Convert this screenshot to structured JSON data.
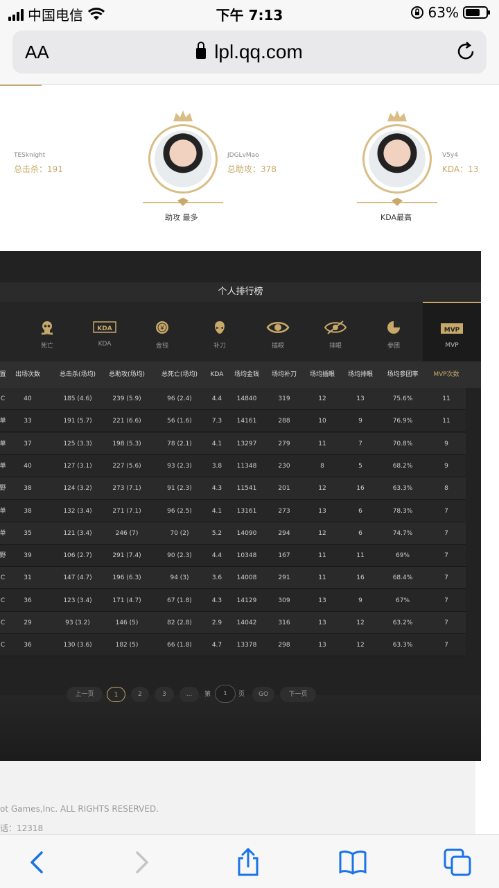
{
  "status_bar": {
    "carrier": "中国电信",
    "time": "下午 7:13",
    "battery": "63%"
  },
  "browser": {
    "text_size_label": "AA",
    "domain": "lpl.qq.com"
  },
  "top_players": [
    {
      "name": "TESknight",
      "stat": "总击杀：191",
      "caption": ""
    },
    {
      "name": "JDGLvMao",
      "stat": "总助攻：378",
      "caption": "助攻 最多"
    },
    {
      "name": "V5y4",
      "stat": "KDA：13",
      "caption": "KDA最高"
    }
  ],
  "ranking": {
    "title": "个人排行榜",
    "tabs": [
      {
        "label": "死亡",
        "icon": "skull-icon"
      },
      {
        "label": "KDA",
        "icon": "kda-icon"
      },
      {
        "label": "金钱",
        "icon": "coin-icon"
      },
      {
        "label": "补刀",
        "icon": "minion-icon"
      },
      {
        "label": "插眼",
        "icon": "eye-icon"
      },
      {
        "label": "排眼",
        "icon": "eye-slash-icon"
      },
      {
        "label": "参团",
        "icon": "pie-icon"
      },
      {
        "label": "MVP",
        "icon": "mvp-icon"
      }
    ],
    "active_tab": "MVP",
    "columns": [
      "置",
      "出场次数",
      "总击杀(场均)",
      "总助攻(场均)",
      "总死亡(场均)",
      "KDA",
      "场均金钱",
      "场均补刀",
      "场均插眼",
      "场均排眼",
      "场均参团率",
      "MVP次数"
    ],
    "rows": [
      [
        "C",
        "40",
        "185 (4.6)",
        "239 (5.9)",
        "96 (2.4)",
        "4.4",
        "14840",
        "319",
        "12",
        "13",
        "75.6%",
        "11"
      ],
      [
        "单",
        "33",
        "191 (5.7)",
        "221 (6.6)",
        "56 (1.6)",
        "7.3",
        "14161",
        "288",
        "10",
        "9",
        "76.9%",
        "11"
      ],
      [
        "单",
        "37",
        "125 (3.3)",
        "198 (5.3)",
        "78 (2.1)",
        "4.1",
        "13297",
        "279",
        "11",
        "7",
        "70.8%",
        "9"
      ],
      [
        "单",
        "40",
        "127 (3.1)",
        "227 (5.6)",
        "93 (2.3)",
        "3.8",
        "11348",
        "230",
        "8",
        "5",
        "68.2%",
        "9"
      ],
      [
        "野",
        "38",
        "124 (3.2)",
        "273 (7.1)",
        "91 (2.3)",
        "4.3",
        "11541",
        "201",
        "12",
        "16",
        "63.3%",
        "8"
      ],
      [
        "单",
        "38",
        "132 (3.4)",
        "271 (7.1)",
        "96 (2.5)",
        "4.1",
        "13161",
        "273",
        "13",
        "6",
        "78.3%",
        "7"
      ],
      [
        "单",
        "35",
        "121 (3.4)",
        "246 (7)",
        "70 (2)",
        "5.2",
        "14090",
        "294",
        "12",
        "6",
        "74.7%",
        "7"
      ],
      [
        "野",
        "39",
        "106 (2.7)",
        "291 (7.4)",
        "90 (2.3)",
        "4.4",
        "10348",
        "167",
        "11",
        "11",
        "69%",
        "7"
      ],
      [
        "C",
        "31",
        "147 (4.7)",
        "196 (6.3)",
        "94 (3)",
        "3.6",
        "14008",
        "291",
        "11",
        "16",
        "68.4%",
        "7"
      ],
      [
        "C",
        "36",
        "123 (3.4)",
        "171 (4.7)",
        "67 (1.8)",
        "4.3",
        "14129",
        "309",
        "13",
        "9",
        "67%",
        "7"
      ],
      [
        "C",
        "29",
        "93 (3.2)",
        "146 (5)",
        "82 (2.8)",
        "2.9",
        "14042",
        "316",
        "13",
        "12",
        "63.2%",
        "7"
      ],
      [
        "C",
        "36",
        "130 (3.6)",
        "182 (5)",
        "66 (1.8)",
        "4.7",
        "13378",
        "298",
        "13",
        "12",
        "63.3%",
        "7"
      ]
    ]
  },
  "pagination": {
    "prev": "上一页",
    "pages": [
      "1",
      "2",
      "3"
    ],
    "ellipsis": "...",
    "goto_prefix": "第",
    "goto_value": "1",
    "goto_suffix": "页",
    "go": "GO",
    "next": "下一页",
    "current": "1"
  },
  "footer": {
    "copyright": "ot Games,Inc. ALL RIGHTS RESERVED.",
    "phone": "话：12318"
  },
  "colors": {
    "gold": "#c8a96a",
    "board_bg": "#222222",
    "ios_blue": "#1a73e8"
  }
}
